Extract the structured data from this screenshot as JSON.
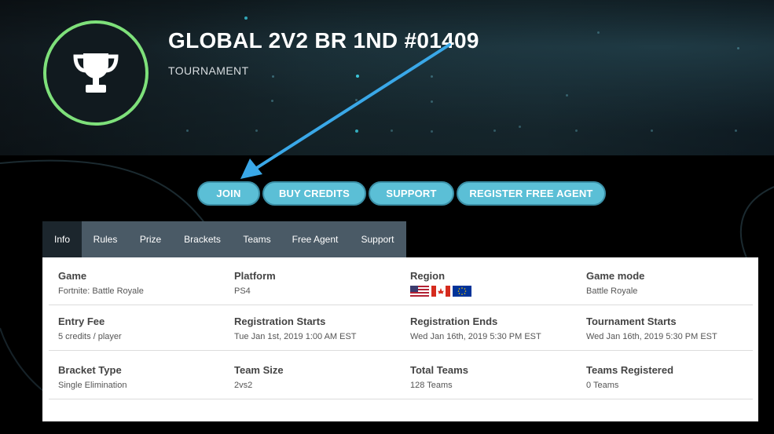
{
  "header": {
    "title": "GLOBAL 2V2 BR 1ND #01409",
    "subtitle": "TOURNAMENT",
    "badge_icon": "trophy-icon",
    "badge_ring_color": "#7ee07a"
  },
  "actions": [
    {
      "label": "JOIN"
    },
    {
      "label": "BUY CREDITS"
    },
    {
      "label": "SUPPORT"
    },
    {
      "label": "REGISTER FREE AGENT"
    }
  ],
  "tabs": [
    {
      "label": "Info",
      "active": true
    },
    {
      "label": "Rules"
    },
    {
      "label": "Prize"
    },
    {
      "label": "Brackets"
    },
    {
      "label": "Teams"
    },
    {
      "label": "Free Agent"
    },
    {
      "label": "Support"
    }
  ],
  "info": {
    "rows": [
      [
        {
          "label": "Game",
          "value": "Fortnite: Battle Royale"
        },
        {
          "label": "Platform",
          "value": "PS4"
        },
        {
          "label": "Region",
          "flags": [
            "us-flag-icon",
            "ca-flag-icon",
            "eu-flag-icon"
          ]
        },
        {
          "label": "Game mode",
          "value": "Battle Royale"
        }
      ],
      [
        {
          "label": "Entry Fee",
          "value": "5 credits / player"
        },
        {
          "label": "Registration Starts",
          "value": "Tue Jan 1st, 2019 1:00 AM EST"
        },
        {
          "label": "Registration Ends",
          "value": "Wed Jan 16th, 2019 5:30 PM EST"
        },
        {
          "label": "Tournament Starts",
          "value": "Wed Jan 16th, 2019 5:30 PM EST"
        }
      ],
      [
        {
          "label": "Bracket Type",
          "value": "Single Elimination"
        },
        {
          "label": "Team Size",
          "value": "2vs2"
        },
        {
          "label": "Total Teams",
          "value": "128 Teams"
        },
        {
          "label": "Teams Registered",
          "value": "0 Teams"
        }
      ]
    ]
  },
  "colors": {
    "accent": "#5bbfd6",
    "arrow": "#3aa8e8"
  }
}
